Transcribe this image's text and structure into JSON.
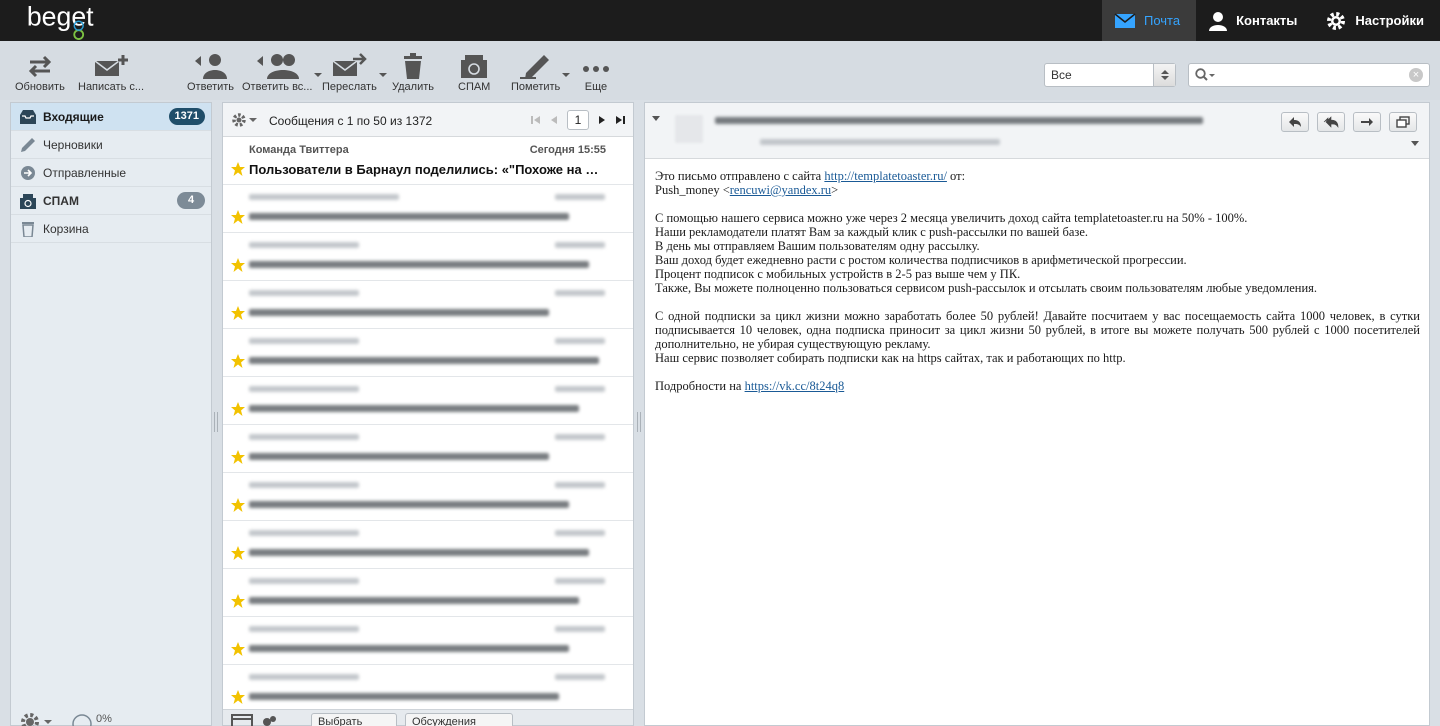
{
  "brand": {
    "logo_text": "beget"
  },
  "topnav": {
    "mail": "Почта",
    "contacts": "Контакты",
    "settings": "Настройки"
  },
  "toolbar": {
    "refresh": "Обновить",
    "compose": "Написать с...",
    "reply": "Ответить",
    "reply_all": "Ответить вс...",
    "forward": "Переслать",
    "delete": "Удалить",
    "spam": "СПАМ",
    "mark": "Пометить",
    "more": "Еще"
  },
  "filter": {
    "value": "Все"
  },
  "search": {
    "placeholder": ""
  },
  "folders": [
    {
      "label": "Входящие",
      "count": "1371",
      "icon": "inbox-icon"
    },
    {
      "label": "Черновики",
      "count": "",
      "icon": "pencil-icon"
    },
    {
      "label": "Отправленные",
      "count": "",
      "icon": "sent-icon"
    },
    {
      "label": "СПАМ",
      "count": "4",
      "icon": "spam-icon"
    },
    {
      "label": "Корзина",
      "count": "",
      "icon": "trash-icon"
    }
  ],
  "quota": {
    "percent": "0%"
  },
  "list": {
    "summary": "Сообщения с 1 по 50 из 1372",
    "page": "1",
    "first_message": {
      "from": "Команда Твиттера",
      "date": "Сегодня 15:55",
      "subject": "Пользователи в Барнаул поделились: «\"Похоже на пр..."
    },
    "footer_select": "Выбрать",
    "footer_threads": "Обсуждения"
  },
  "reader": {
    "body": {
      "line1_prefix": "Это письмо отправлено с сайта",
      "line1_link": "http://templatetoaster.ru/",
      "line1_suffix": "от:",
      "line2_prefix": "Push_money <",
      "line2_link": "rencuwi@yandex.ru",
      "line2_suffix": ">",
      "para1": "С помощью нашего сервиса можно уже через 2 месяца увеличить доход сайта templatetoaster.ru на 50% - 100%.",
      "para2": "Наши рекламодатели платят Вам за каждый клик с push-рассылки по вашей базе.",
      "para3": "В день мы отправляем Вашим пользователям одну рассылку.",
      "para4": "Ваш доход будет ежедневно расти с ростом количества подписчиков в арифметической прогрессии.",
      "para5": "Процент подписок с мобильных устройств в 2-5 раз выше чем у ПК.",
      "para6": "Также, Вы можете полноценно пользоваться сервисом push-рассылок и отсылать своим пользователям любые уведомления.",
      "para7": "С одной подписки за цикл жизни можно заработать более 50 рублей! Давайте посчитаем у вас посещаемость сайта 1000 человек, в сутки подписывается 10 человек, одна подписка приносит за цикл жизни 50 рублей, в итоге вы можете получать 500 рублей с 1000 посетителей дополнительно, не убирая существующую рекламу.",
      "para8": "Наш сервис позволяет собирать подписки как на https сайтах, так и работающих по http.",
      "more_prefix": "Подробности на",
      "more_link": "https://vk.cc/8t24q8"
    }
  },
  "colors": {
    "accent": "#35a4ff",
    "badge": "#1f4e6a",
    "topbar": "#1c1c1c"
  }
}
